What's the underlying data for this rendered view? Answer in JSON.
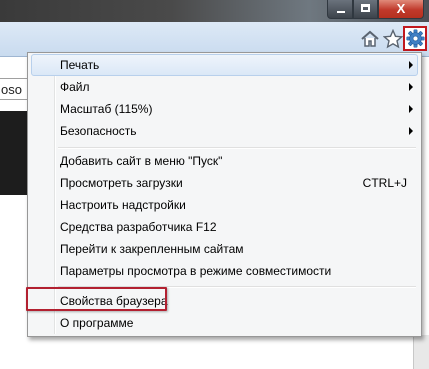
{
  "window": {
    "minimize_icon": "minimize-icon",
    "maximize_icon": "maximize-icon",
    "close_icon": "close-icon",
    "close_glyph": "X"
  },
  "toolbar": {
    "icons": [
      "home-icon",
      "star-icon",
      "gear-icon"
    ],
    "accent_color": "#c0181e"
  },
  "page": {
    "tab_text": "oso"
  },
  "menu": {
    "group1": [
      {
        "label": "Печать",
        "submenu": true
      },
      {
        "label": "Файл",
        "submenu": true
      },
      {
        "label": "Масштаб (115%)",
        "submenu": true
      },
      {
        "label": "Безопасность",
        "submenu": true
      }
    ],
    "group2": [
      {
        "label": "Добавить сайт в меню \"Пуск\"",
        "shortcut": ""
      },
      {
        "label": "Просмотреть загрузки",
        "shortcut": "CTRL+J"
      },
      {
        "label": "Настроить надстройки",
        "shortcut": ""
      },
      {
        "label": "Средства разработчика F12",
        "shortcut": ""
      },
      {
        "label": "Перейти к закрепленным сайтам",
        "shortcut": ""
      },
      {
        "label": "Параметры просмотра в режиме совместимости",
        "shortcut": ""
      }
    ],
    "group3": [
      {
        "label": "Свойства браузера"
      },
      {
        "label": "О программе"
      }
    ],
    "highlight_color": "#b22030"
  }
}
